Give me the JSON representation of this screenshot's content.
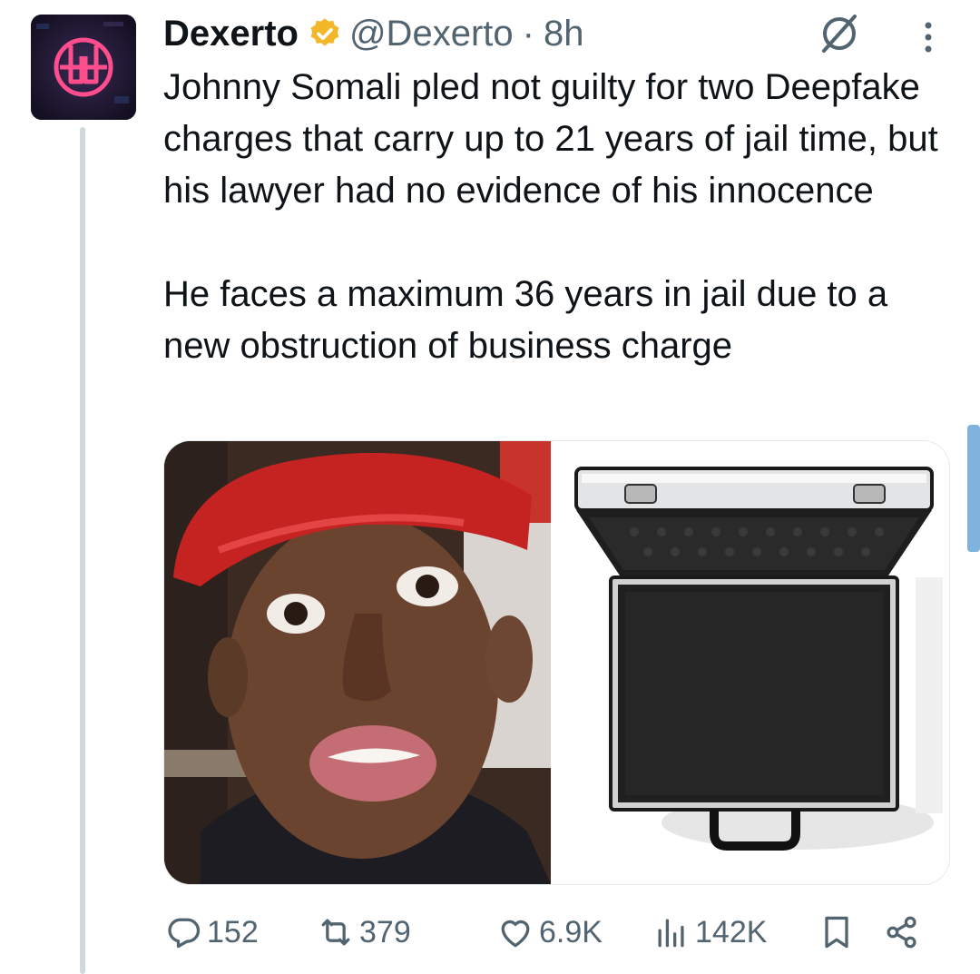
{
  "tweet": {
    "author_name": "Dexerto",
    "handle": "@Dexerto",
    "separator": "·",
    "time": "8h",
    "text_paragraph_1": "Johnny Somali pled not guilty for two Deepfake charges that carry up to 21 years of jail time, but his lawyer had no evidence of his innocence",
    "text_paragraph_2": "He faces a maximum 36 years in jail due to a new obstruction of business charge"
  },
  "actions": {
    "replies": "152",
    "reposts": "379",
    "likes": "6.9K",
    "views": "142K"
  },
  "icons": {
    "verified": "verified-gold-badge-icon",
    "grok": "grok-icon",
    "more": "more-vertical-icon",
    "reply": "reply-icon",
    "repost": "repost-icon",
    "like": "heart-icon",
    "views": "views-icon",
    "bookmark": "bookmark-icon",
    "share": "share-icon"
  },
  "colors": {
    "text": "#0f1419",
    "secondary": "#536471",
    "verified_gold": "#f2b829",
    "thread_line": "#cfd9de",
    "logo_pink": "#ff3d7f"
  }
}
